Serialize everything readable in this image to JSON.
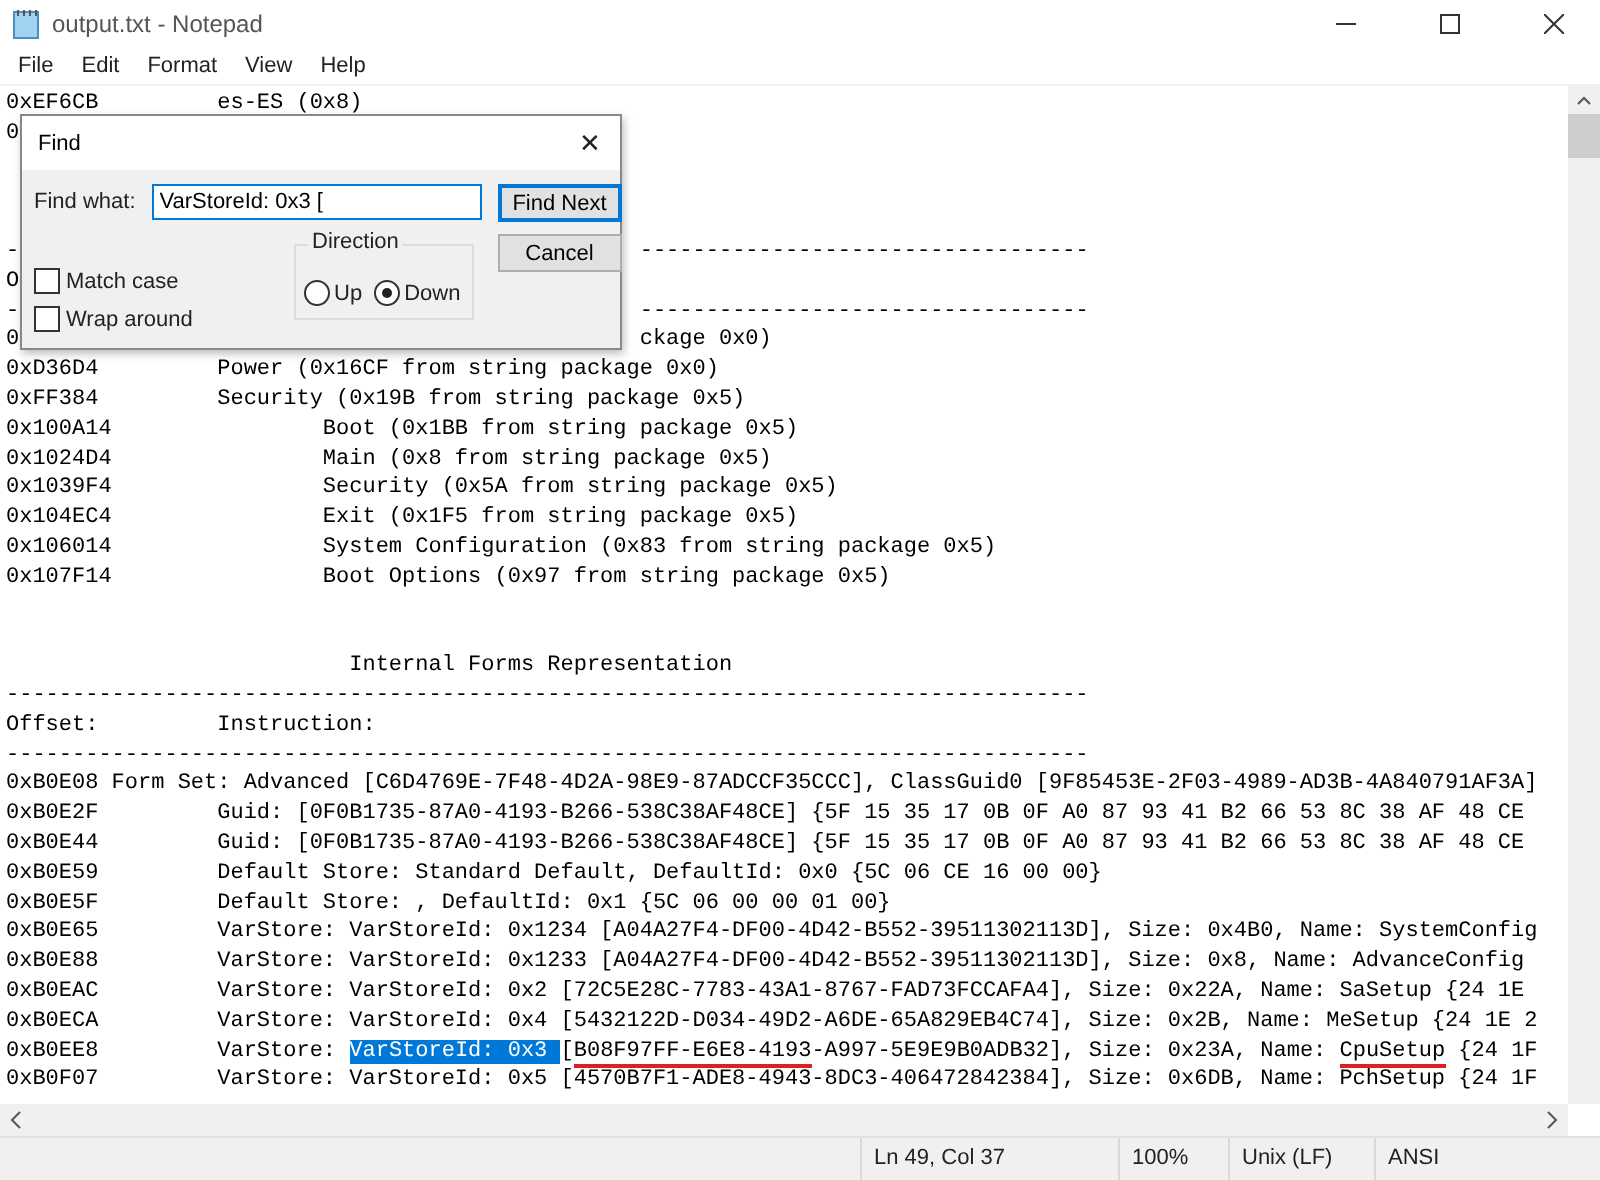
{
  "window": {
    "title": "output.txt - Notepad"
  },
  "menu": [
    {
      "label": "File"
    },
    {
      "label": "Edit"
    },
    {
      "label": "Format"
    },
    {
      "label": "View"
    },
    {
      "label": "Help"
    }
  ],
  "editor": {
    "lines": [
      {
        "kind": "text",
        "text": "0xEF6CB         es-ES (0x8)"
      },
      {
        "kind": "text",
        "text": "0"
      },
      {
        "kind": "blank"
      },
      {
        "kind": "blank"
      },
      {
        "kind": "blank"
      },
      {
        "kind": "split",
        "text": "-",
        "right": "----------------------------------"
      },
      {
        "kind": "text",
        "text": "O"
      },
      {
        "kind": "split",
        "text": "-",
        "right": "----------------------------------"
      },
      {
        "kind": "split",
        "text": "0",
        "right": "ckage 0x0)"
      },
      {
        "kind": "text",
        "text": "0xD36D4         Power (0x16CF from string package 0x0)"
      },
      {
        "kind": "text",
        "text": "0xFF384         Security (0x19B from string package 0x5)"
      },
      {
        "kind": "text",
        "text": "0x100A14                Boot (0x1BB from string package 0x5)"
      },
      {
        "kind": "text",
        "text": "0x1024D4                Main (0x8 from string package 0x5)"
      },
      {
        "kind": "text",
        "text": "0x1039F4                Security (0x5A from string package 0x5)"
      },
      {
        "kind": "text",
        "text": "0x104EC4                Exit (0x1F5 from string package 0x5)"
      },
      {
        "kind": "text",
        "text": "0x106014                System Configuration (0x83 from string package 0x5)"
      },
      {
        "kind": "text",
        "text": "0x107F14                Boot Options (0x97 from string package 0x5)"
      },
      {
        "kind": "blank"
      },
      {
        "kind": "blank"
      },
      {
        "kind": "text",
        "text": "                          Internal Forms Representation"
      },
      {
        "kind": "text",
        "text": "----------------------------------------------------------------------------------"
      },
      {
        "kind": "text",
        "text": "Offset:         Instruction:"
      },
      {
        "kind": "text",
        "text": "----------------------------------------------------------------------------------"
      },
      {
        "kind": "text",
        "text": "0xB0E08 Form Set: Advanced [C6D4769E-7F48-4D2A-98E9-87ADCCF35CCC], ClassGuid0 [9F85453E-2F03-4989-AD3B-4A840791AF3A]"
      },
      {
        "kind": "text",
        "text": "0xB0E2F         Guid: [0F0B1735-87A0-4193-B266-538C38AF48CE] {5F 15 35 17 0B 0F A0 87 93 41 B2 66 53 8C 38 AF 48 CE"
      },
      {
        "kind": "text",
        "text": "0xB0E44         Guid: [0F0B1735-87A0-4193-B266-538C38AF48CE] {5F 15 35 17 0B 0F A0 87 93 41 B2 66 53 8C 38 AF 48 CE"
      },
      {
        "kind": "text",
        "text": "0xB0E59         Default Store: Standard Default, DefaultId: 0x0 {5C 06 CE 16 00 00}"
      },
      {
        "kind": "text",
        "text": "0xB0E5F         Default Store: , DefaultId: 0x1 {5C 06 00 00 01 00}"
      },
      {
        "kind": "text",
        "text": "0xB0E65         VarStore: VarStoreId: 0x1234 [A04A27F4-DF00-4D42-B552-39511302113D], Size: 0x4B0, Name: SystemConfig"
      },
      {
        "kind": "text",
        "text": "0xB0E88         VarStore: VarStoreId: 0x1233 [A04A27F4-DF00-4D42-B552-39511302113D], Size: 0x8, Name: AdvanceConfig"
      },
      {
        "kind": "text",
        "text": "0xB0EAC         VarStore: VarStoreId: 0x2 [72C5E28C-7783-43A1-8767-FAD73FCCAFA4], Size: 0x22A, Name: SaSetup {24 1E"
      },
      {
        "kind": "text",
        "text": "0xB0ECA         VarStore: VarStoreId: 0x4 [5432122D-D034-49D2-A6DE-65A829EB4C74], Size: 0x2B, Name: MeSetup {24 1E 2"
      },
      {
        "kind": "segments",
        "segments": [
          {
            "text": "0xB0EE8         VarStore: ",
            "kind": "plain"
          },
          {
            "text": "VarStoreId: 0x3 ",
            "kind": "selected"
          },
          {
            "text": "[",
            "kind": "plain"
          },
          {
            "text": "B08F97FF-E6E8-4193",
            "kind": "underlined"
          },
          {
            "text": "-A997-5E9E9B0ADB32], Size: 0x23A, Name: ",
            "kind": "plain"
          },
          {
            "text": "CpuSetup",
            "kind": "underlined"
          },
          {
            "text": " {24 1F",
            "kind": "plain"
          }
        ]
      },
      {
        "kind": "text",
        "text": "0xB0F07         VarStore: VarStoreId: 0x5 [4570B7F1-ADE8-4943-8DC3-406472842384], Size: 0x6DB, Name: PchSetup {24 1F"
      }
    ]
  },
  "status_bar": [
    {
      "text": "Ln 49, Col 37"
    },
    {
      "text": "100%"
    },
    {
      "text": "Unix (LF)"
    },
    {
      "text": "ANSI"
    }
  ],
  "find_dialog": {
    "title": "Find",
    "close": "✕",
    "find_what_label": "Find what:",
    "find_what_value": "VarStoreId: 0x3 [",
    "buttons": [
      {
        "label": "Find Next",
        "default": true
      },
      {
        "label": "Cancel",
        "default": false
      }
    ],
    "direction": {
      "label": "Direction",
      "options": [
        {
          "label": "Up",
          "selected": false
        },
        {
          "label": "Down",
          "selected": true
        }
      ]
    },
    "options": [
      {
        "label": "Match case",
        "checked": false
      },
      {
        "label": "Wrap around",
        "checked": false
      }
    ]
  }
}
